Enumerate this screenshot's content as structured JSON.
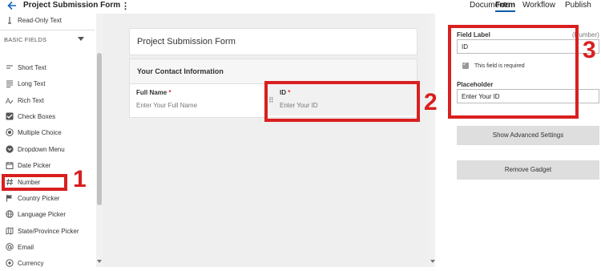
{
  "header": {
    "form_title": "Project Submission Form",
    "tabs": [
      {
        "label": "Documents"
      },
      {
        "label": "Form"
      },
      {
        "label": "Workflow"
      },
      {
        "label": "Publish"
      }
    ]
  },
  "sidebar": {
    "top_item": "Read-Only Text",
    "section_label": "BASIC FIELDS",
    "items": [
      {
        "label": "Short Text",
        "icon": "short-text-icon"
      },
      {
        "label": "Long Text",
        "icon": "long-text-icon"
      },
      {
        "label": "Rich Text",
        "icon": "rich-text-icon"
      },
      {
        "label": "Check Boxes",
        "icon": "checkbox-icon"
      },
      {
        "label": "Multiple Choice",
        "icon": "radio-icon"
      },
      {
        "label": "Dropdown Menu",
        "icon": "dropdown-icon"
      },
      {
        "label": "Date Picker",
        "icon": "calendar-icon"
      },
      {
        "label": "Number",
        "icon": "hash-icon"
      },
      {
        "label": "Country Picker",
        "icon": "flag-icon"
      },
      {
        "label": "Language Picker",
        "icon": "globe-icon"
      },
      {
        "label": "State/Province Picker",
        "icon": "map-icon"
      },
      {
        "label": "Email",
        "icon": "at-icon"
      },
      {
        "label": "Currency",
        "icon": "currency-icon"
      }
    ]
  },
  "canvas": {
    "form_name": "Project Submission Form",
    "section_title": "Your Contact Information",
    "fields": [
      {
        "label": "Full Name",
        "required_mark": "*",
        "placeholder": "Enter Your Full Name"
      },
      {
        "label": "ID",
        "required_mark": "*",
        "placeholder": "Enter Your ID"
      }
    ]
  },
  "properties": {
    "field_label_heading": "Field Label",
    "field_type": "(Number)",
    "field_label_value": "ID",
    "required_label": "This field is required",
    "placeholder_heading": "Placeholder",
    "placeholder_value": "Enter Your ID",
    "advanced_button": "Show Advanced Settings",
    "remove_button": "Remove Gadget"
  },
  "annotations": [
    "1",
    "2",
    "3"
  ],
  "colors": {
    "annotation": "#d91f1f",
    "accent": "#0c5aa6",
    "required": "#d32f2f"
  }
}
